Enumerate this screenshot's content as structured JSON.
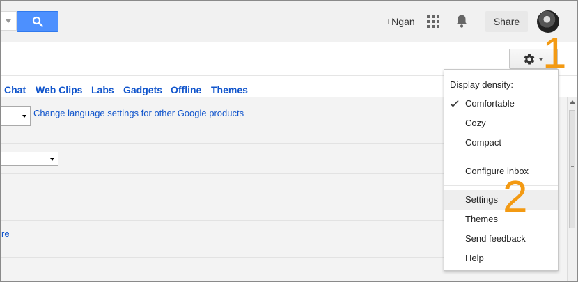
{
  "topbar": {
    "user_link": "+Ngan",
    "share_label": "Share",
    "icons": [
      "search-icon",
      "apps-icon",
      "bell-icon",
      "avatar"
    ]
  },
  "settings_tabs": [
    "Chat",
    "Web Clips",
    "Labs",
    "Gadgets",
    "Offline",
    "Themes"
  ],
  "content": {
    "language_link": "Change language settings for other Google products",
    "more_link": "re"
  },
  "menu": {
    "heading": "Display density:",
    "density_items": [
      "Comfortable",
      "Cozy",
      "Compact"
    ],
    "selected_density": "Comfortable",
    "configure_label": "Configure inbox",
    "settings_label": "Settings",
    "themes_label": "Themes",
    "feedback_label": "Send feedback",
    "help_label": "Help"
  },
  "annotations": [
    "1",
    "2"
  ],
  "colors": {
    "accent_blue": "#4d90fe",
    "link_blue": "#1155cc",
    "annotation_orange": "#f39a13"
  }
}
